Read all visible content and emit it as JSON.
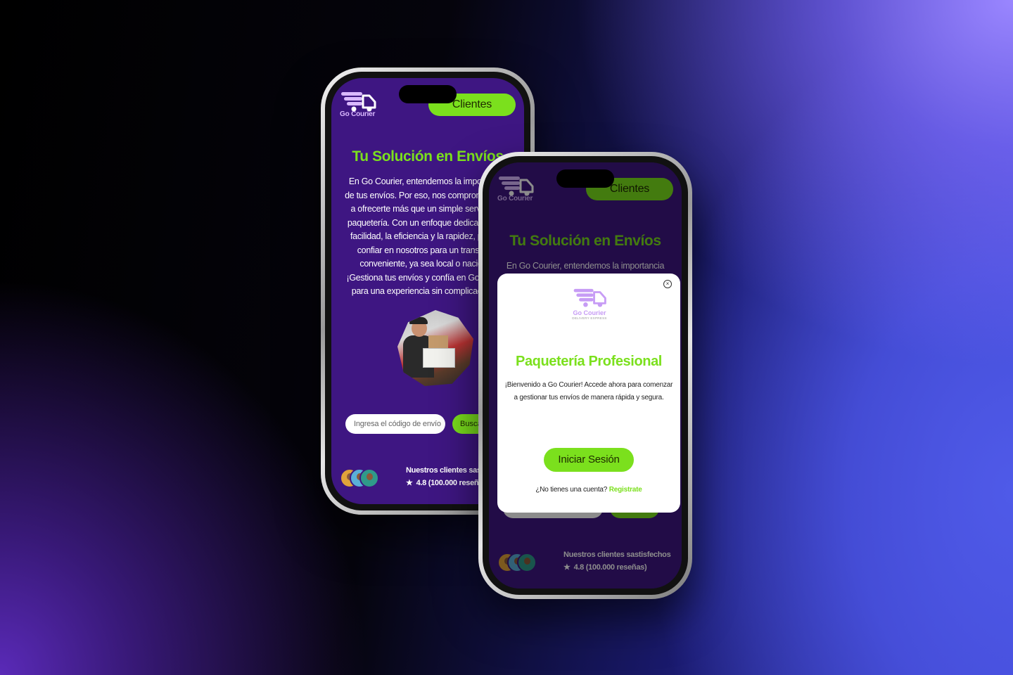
{
  "brand": {
    "name": "Go Courier",
    "tagline": "DELIVERY EXPRESS",
    "accent": "#7be01d",
    "primary": "#3e1682",
    "logo_color": "#d9b8ff"
  },
  "header": {
    "clients_label": "Clientes"
  },
  "hero": {
    "title": "Tu Solución en Envíos",
    "description": "En Go Courier, entendemos la importancia de tus envíos. Por eso, nos comprometemos a ofrecerte más que un simple servicio de paquetería. Con un enfoque dedicado en la facilidad, la eficiencia y la rapidez, puedes confiar en nosotros para un transporte conveniente, ya sea local o nacional. ¡Gestiona tus envíos y confía en Go Courier para una experiencia sin complicaciones!"
  },
  "search": {
    "placeholder": "Ingresa el código de envío",
    "button": "Buscar"
  },
  "reviews": {
    "title": "Nuestros clientes sastisfechos",
    "rating": "4.8 (100.000 reseñas)"
  },
  "modal": {
    "title": "Paquetería Profesional",
    "text": "¡Bienvenido a Go Courier! Accede ahora para comenzar a gestionar tus envíos de manera rápida y segura.",
    "login_button": "Iniciar Sesión",
    "register_prompt": "¿No tienes una cuenta?",
    "register_link": "Registrate",
    "close_icon": "×"
  },
  "icons": {
    "star": "★"
  }
}
